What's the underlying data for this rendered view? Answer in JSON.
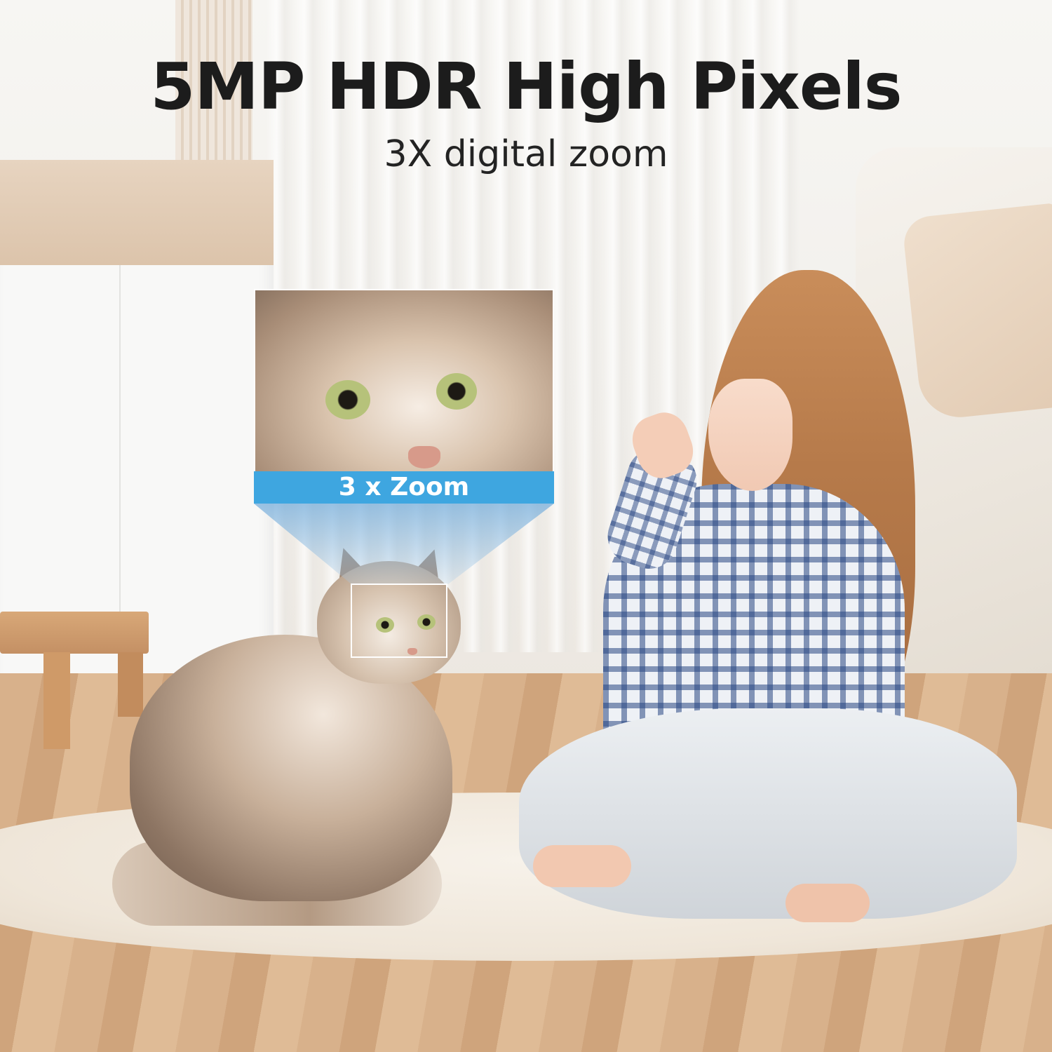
{
  "headline": {
    "title": "5MP HDR High Pixels",
    "subtitle": "3X digital zoom"
  },
  "zoom_inset": {
    "label": "3 x Zoom",
    "band_color": "#3ea6e0"
  },
  "scene": {
    "subject": "girl playing with long-haired cat on rug"
  }
}
